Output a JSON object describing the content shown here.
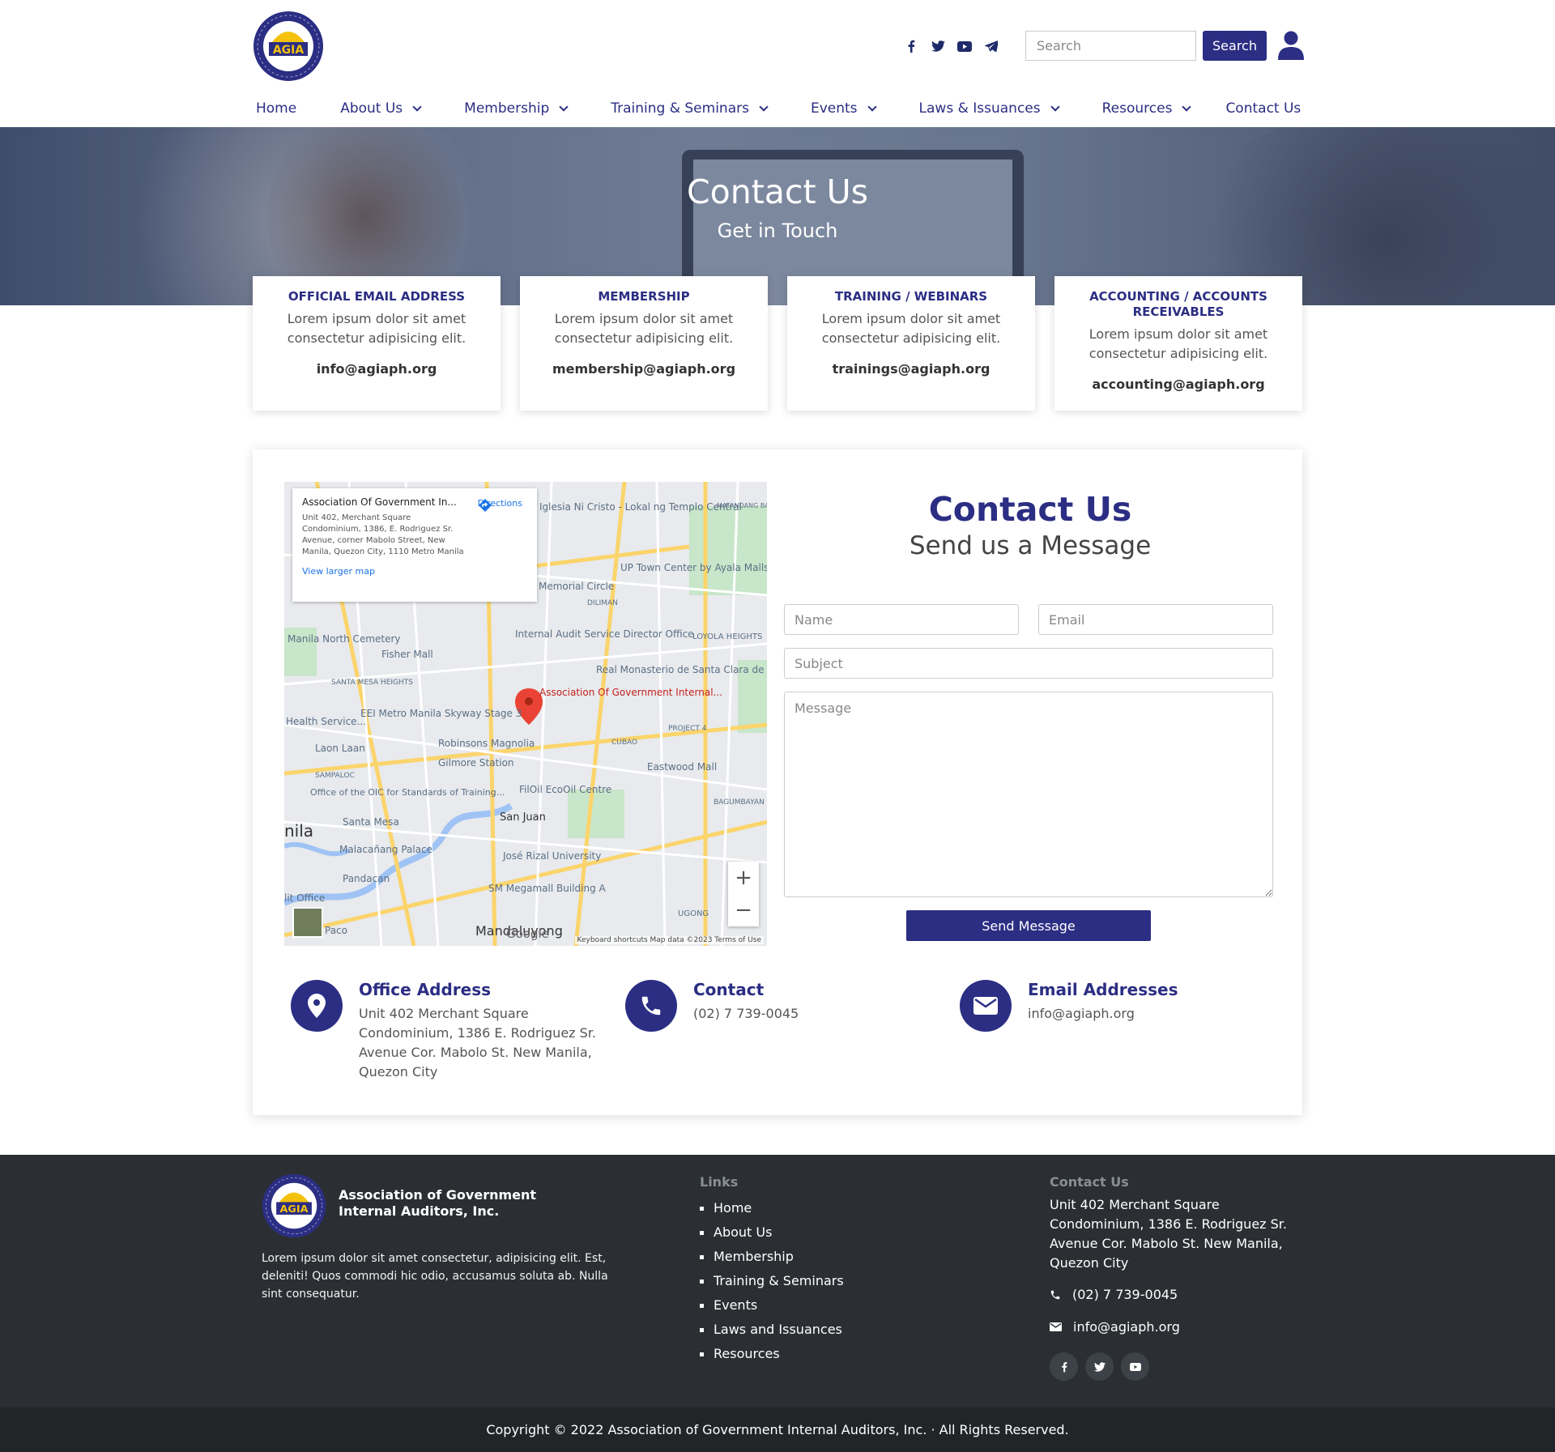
{
  "header": {
    "logo_text": "AGIA",
    "social": [
      "facebook-icon",
      "twitter-icon",
      "youtube-icon",
      "telegram-icon"
    ],
    "search_placeholder": "Search",
    "search_button": "Search"
  },
  "nav": [
    {
      "label": "Home",
      "dropdown": false
    },
    {
      "label": "About Us",
      "dropdown": true
    },
    {
      "label": "Membership",
      "dropdown": true
    },
    {
      "label": "Training & Seminars",
      "dropdown": true
    },
    {
      "label": "Events",
      "dropdown": true
    },
    {
      "label": "Laws & Issuances",
      "dropdown": true
    },
    {
      "label": "Resources",
      "dropdown": true
    },
    {
      "label": "Contact Us",
      "dropdown": false
    }
  ],
  "hero": {
    "title": "Contact Us",
    "subtitle": "Get in Touch"
  },
  "cards": [
    {
      "title": "OFFICIAL EMAIL ADDRESS",
      "text": "Lorem ipsum dolor sit amet consectetur adipisicing elit.",
      "email": "info@agiaph.org"
    },
    {
      "title": "MEMBERSHIP",
      "text": "Lorem ipsum dolor sit amet consectetur adipisicing elit.",
      "email": "membership@agiaph.org"
    },
    {
      "title": "TRAINING / WEBINARS",
      "text": "Lorem ipsum dolor sit amet consectetur adipisicing elit.",
      "email": "trainings@agiaph.org"
    },
    {
      "title": "ACCOUNTING / ACCOUNTS RECEIVABLES",
      "text": "Lorem ipsum dolor sit amet consectetur adipisicing elit.",
      "email": "accounting@agiaph.org"
    }
  ],
  "map": {
    "place_name": "Association Of Government In...",
    "address": "Unit 402, Merchant Square Condominium, 1386, E. Rodriguez Sr. Avenue, corner Mabolo Street, New Manila, Quezon City, 1110 Metro Manila",
    "directions": "Directions",
    "larger_map": "View larger map",
    "pin_label": "Association Of Government Internal...",
    "labels": [
      "Manila North Cemetery",
      "Fisher Mall",
      "Internal Audit Service Director Office",
      "Real Monasterio de Santa Clara de Manila",
      "UP Town Center by Ayala Malls",
      "Iglesia Ni Cristo - Lokal ng Templo Central",
      "Robinsons Magnolia",
      "Gilmore Station",
      "Eastwood Mall",
      "FilOil EcoOil Centre",
      "San Juan",
      "José Rizal University",
      "Malacañang Palace",
      "Santa Mesa",
      "Pandacan",
      "SM Megamall Building A",
      "Mandaluyong",
      "EEI Metro Manila Skyway Stage 3",
      "Office of the OIC for Standards of Training...",
      "Laon Laan",
      "LOYOLA HEIGHTS",
      "SANTA MESA HEIGHTS",
      "SAMPALOC",
      "DILIMAN",
      "CUBAO",
      "PROJECT 4",
      "BAGUMBAYAN",
      "UGONG",
      "MATANDANG BALARA",
      "Memorial Circle",
      "Health Service...",
      "nila",
      "lit Office",
      "Paco"
    ],
    "footer": "Keyboard shortcuts   Map data ©2023   Terms of Use",
    "google": "Google"
  },
  "form": {
    "title": "Contact Us",
    "subtitle": "Send us a Message",
    "name_placeholder": "Name",
    "email_placeholder": "Email",
    "subject_placeholder": "Subject",
    "message_placeholder": "Message",
    "send_button": "Send Message"
  },
  "info": [
    {
      "title": "Office Address",
      "text": "Unit 402 Merchant Square Condominium, 1386 E. Rodriguez Sr. Avenue Cor. Mabolo St. New Manila, Quezon City",
      "icon": "location-pin-icon"
    },
    {
      "title": "Contact",
      "text": "(02) 7 739-0045",
      "icon": "phone-icon"
    },
    {
      "title": "Email Addresses",
      "text": "info@agiaph.org",
      "icon": "envelope-icon"
    }
  ],
  "footer": {
    "org_name": "Association of Government Internal Auditors, Inc.",
    "description": "Lorem ipsum dolor sit amet consectetur, adipisicing elit. Est, deleniti! Quos commodi hic odio, accusamus soluta ab. Nulla sint consequatur.",
    "links_heading": "Links",
    "links": [
      "Home",
      "About Us",
      "Membership",
      "Training & Seminars",
      "Events",
      "Laws and Issuances",
      "Resources"
    ],
    "contact_heading": "Contact Us",
    "address": "Unit 402 Merchant Square Condominium, 1386 E. Rodriguez Sr. Avenue Cor. Mabolo St. New Manila, Quezon City",
    "phone": "(02) 7 739-0045",
    "email": "info@agiaph.org",
    "social": [
      "facebook-icon",
      "twitter-icon",
      "youtube-icon"
    ],
    "copyright": "Copyright © 2022 Association of Government Internal Auditors, Inc. · All Rights Reserved."
  },
  "colors": {
    "brand": "#2b2e83",
    "footer_bg": "#2b2f33",
    "copyright_bg": "#222528"
  }
}
